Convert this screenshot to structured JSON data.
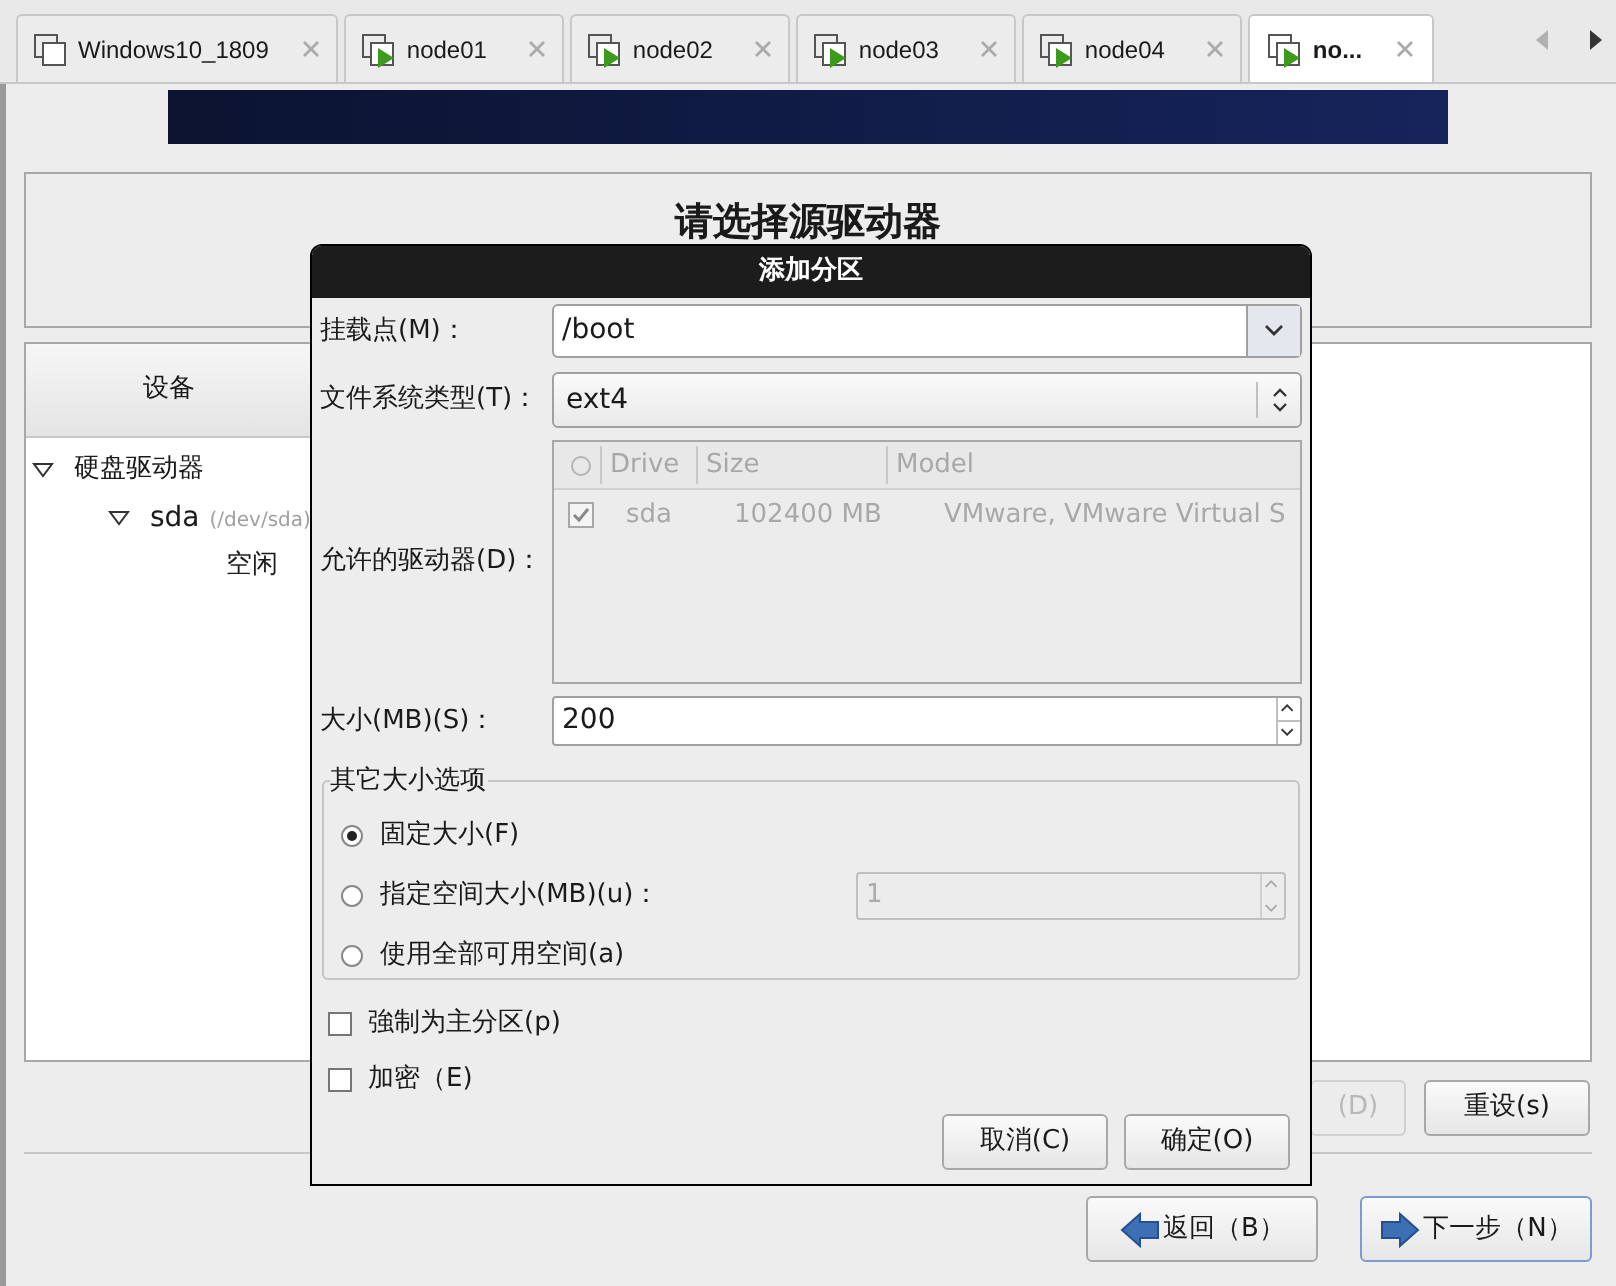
{
  "tabs": [
    {
      "label": "Windows10_1809",
      "kind": "stopped",
      "selected": false
    },
    {
      "label": "node01",
      "kind": "running",
      "selected": false
    },
    {
      "label": "node02",
      "kind": "running",
      "selected": false
    },
    {
      "label": "node03",
      "kind": "running",
      "selected": false
    },
    {
      "label": "node04",
      "kind": "running",
      "selected": false
    },
    {
      "label": "no...",
      "kind": "running",
      "selected": true
    }
  ],
  "installer": {
    "heading": "请选择源驱动器",
    "device_table": {
      "column": "设备",
      "tree": [
        {
          "label": "硬盘驱动器",
          "expanded": true,
          "children": [
            {
              "label": "sda",
              "path": "(/dev/sda)",
              "expanded": true,
              "children": [
                {
                  "label": "空闲"
                }
              ]
            }
          ]
        }
      ]
    },
    "buttons": [
      {
        "label": "(D)",
        "disabled": true
      },
      {
        "label": "重设(s)",
        "disabled": false
      }
    ],
    "nav_buttons": [
      {
        "label": "返回（B）",
        "kind": "back",
        "focused": false
      },
      {
        "label": "下一步（N）",
        "kind": "next",
        "focused": true
      }
    ]
  },
  "dialog": {
    "title": "添加分区",
    "mount_point": {
      "label": "挂载点(M)：",
      "value": "/boot"
    },
    "fs_type": {
      "label": "文件系统类型(T)：",
      "value": "ext4"
    },
    "allowed_drives": {
      "label": "允许的驱动器(D)：",
      "disabled": true,
      "columns": [
        "Drive",
        "Size",
        "Model"
      ],
      "rows": [
        {
          "checked": true,
          "drive": "sda",
          "size": "102400 MB",
          "model": "VMware, VMware Virtual S"
        }
      ]
    },
    "size": {
      "label": "大小(MB)(S)：",
      "value": "200"
    },
    "size_options": {
      "legend": "其它大小选项",
      "options": [
        {
          "label": "固定大小(F)",
          "kind": "plain",
          "selected": true
        },
        {
          "label": "指定空间大小(MB)(u)：",
          "kind": "spin",
          "value": "1",
          "selected": false
        },
        {
          "label": "使用全部可用空间(a)",
          "kind": "plain",
          "selected": false
        }
      ]
    },
    "checkboxes": [
      {
        "label": "強制为主分区(p)",
        "checked": false
      },
      {
        "label": "加密（E)",
        "checked": false
      }
    ],
    "buttons": [
      "取消(C)",
      "确定(O)"
    ]
  }
}
